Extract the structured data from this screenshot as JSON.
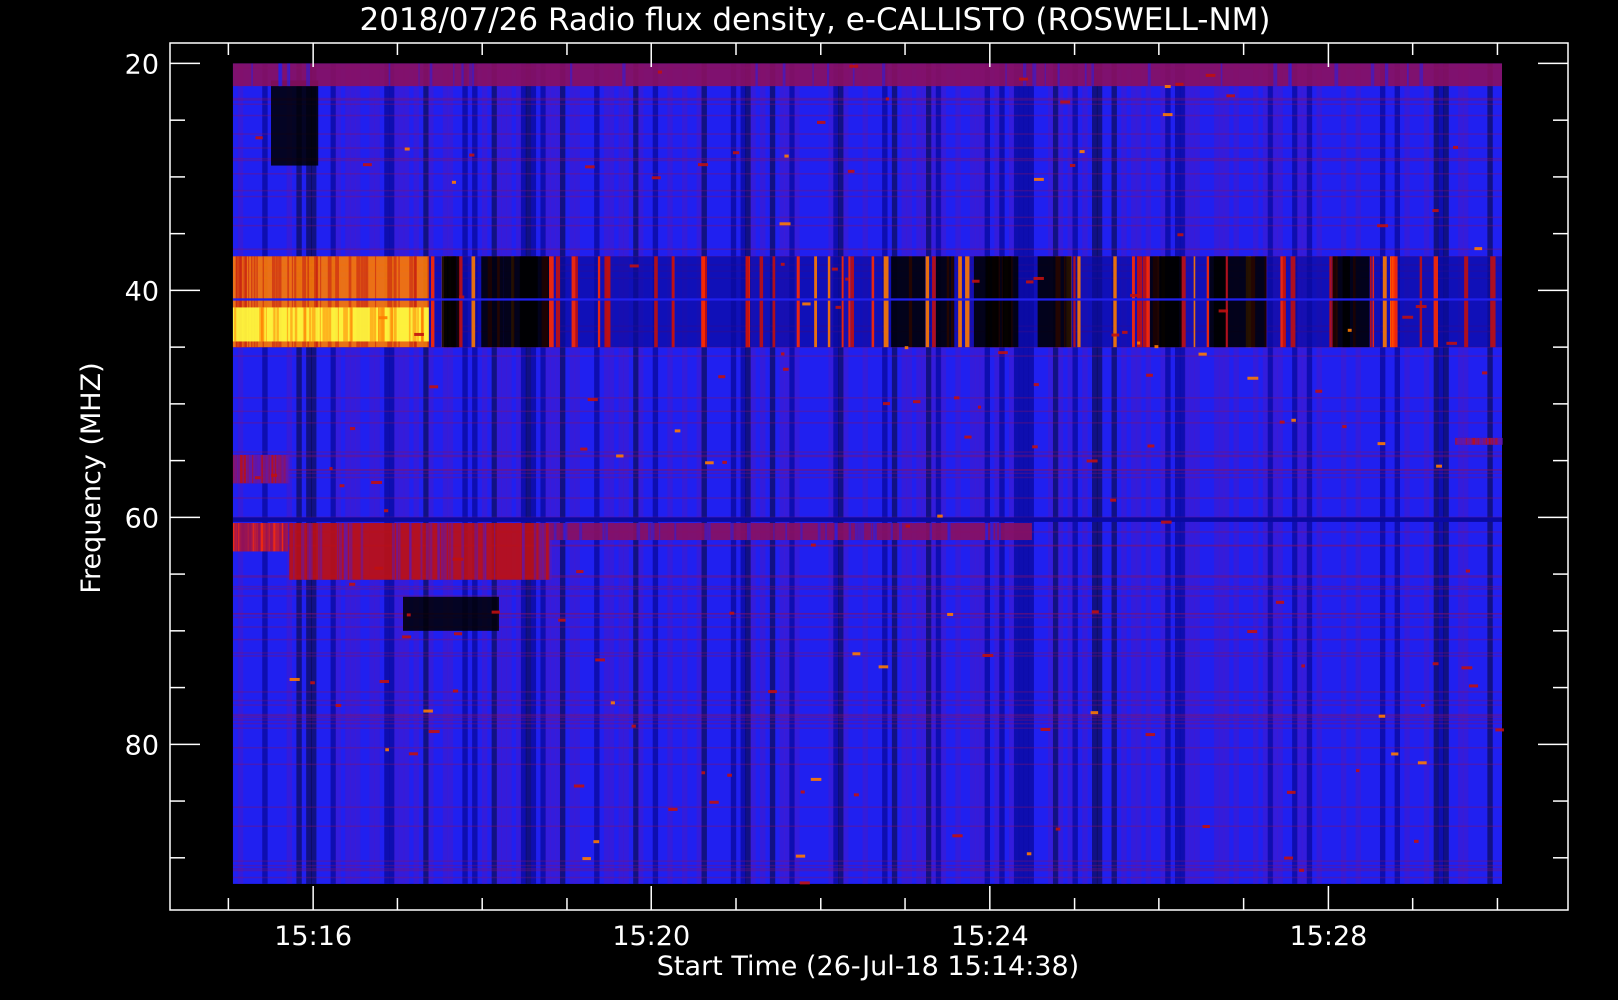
{
  "chart_data": {
    "type": "heatmap",
    "title": "2018/07/26  Radio flux density, e-CALLISTO (ROSWELL-NM)",
    "xlabel": "Start Time (26-Jul-18 15:14:38)",
    "ylabel": "Frequency (MHZ)",
    "x_ticks": [
      {
        "value": 15.2667,
        "label": "15:16"
      },
      {
        "value": 15.3333,
        "label": "15:20"
      },
      {
        "value": 15.4,
        "label": "15:24"
      },
      {
        "value": 15.4667,
        "label": "15:28"
      }
    ],
    "x_minor_ticks": [
      15.25,
      15.2833,
      15.3,
      15.3167,
      15.35,
      15.3667,
      15.3833,
      15.4167,
      15.4333,
      15.45,
      15.4833,
      15.5
    ],
    "xlim": [
      15.2385,
      15.5139
    ],
    "data_x_range": [
      15.2509,
      15.5009
    ],
    "y_ticks": [
      {
        "value": 20,
        "label": "20"
      },
      {
        "value": 40,
        "label": "40"
      },
      {
        "value": 60,
        "label": "60"
      },
      {
        "value": 80,
        "label": "80"
      }
    ],
    "y_minor_ticks": [
      25,
      30,
      35,
      45,
      50,
      55,
      65,
      70,
      75,
      85,
      90
    ],
    "ylim": [
      18.2,
      94.6
    ],
    "data_y_range": [
      20,
      92.3
    ],
    "y_reversed": true,
    "colormap": [
      "#000000",
      "#0a0aa0",
      "#2020f0",
      "#5a18b8",
      "#8a1060",
      "#c01010",
      "#ff2a00",
      "#ff7a00",
      "#ffcc00",
      "#ffff40"
    ],
    "features": [
      {
        "kind": "band",
        "x": [
          15.2509,
          15.2895
        ],
        "y": [
          37,
          45
        ],
        "intensity": 7,
        "name": "strong band left"
      },
      {
        "kind": "band",
        "x": [
          15.2509,
          15.2895
        ],
        "y": [
          41.5,
          44.5
        ],
        "intensity": 9
      },
      {
        "kind": "stripes",
        "x": [
          15.2895,
          15.5009
        ],
        "y": [
          37,
          45
        ],
        "intensity": 6
      },
      {
        "kind": "band",
        "x": [
          15.2509,
          15.2617
        ],
        "y": [
          60.5,
          63
        ],
        "intensity": 6
      },
      {
        "kind": "band",
        "x": [
          15.262,
          15.3133
        ],
        "y": [
          60.5,
          65.5
        ],
        "intensity": 5
      },
      {
        "kind": "band",
        "x": [
          15.3133,
          15.4083
        ],
        "y": [
          60.5,
          62
        ],
        "intensity": 4
      },
      {
        "kind": "dark",
        "x": [
          15.2844,
          15.3033
        ],
        "y": [
          67,
          70
        ],
        "intensity": 0
      },
      {
        "kind": "dark",
        "x": [
          15.2584,
          15.2677
        ],
        "y": [
          21.5,
          29
        ],
        "intensity": 0
      },
      {
        "kind": "band",
        "x": [
          15.2509,
          15.2617
        ],
        "y": [
          54.5,
          57
        ],
        "intensity": 5
      },
      {
        "kind": "band",
        "x": [
          15.4917,
          15.5009
        ],
        "y": [
          53,
          53.6
        ],
        "intensity": 5
      },
      {
        "kind": "line",
        "x": [
          15.2509,
          15.5009
        ],
        "y": [
          40.7,
          40.9
        ],
        "intensity": 2
      },
      {
        "kind": "line",
        "x": [
          15.2509,
          15.5009
        ],
        "y": [
          60,
          60.4
        ],
        "intensity": 1
      },
      {
        "kind": "band",
        "x": [
          15.2509,
          15.5009
        ],
        "y": [
          20,
          22
        ],
        "intensity": 4
      }
    ]
  }
}
